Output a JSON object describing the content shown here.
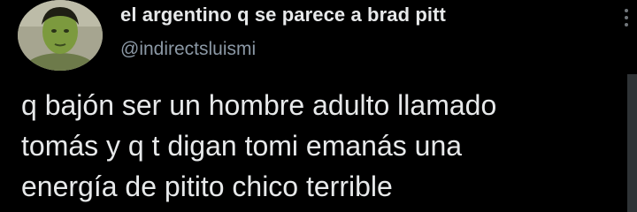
{
  "tweet": {
    "author": {
      "display_name": "el argentino q se parece a brad pitt",
      "handle": "@indirectsluismi"
    },
    "text": "q bajón ser un hombre adulto llamado\ntomás y q t digan tomi emanás una\nenergía de pitito chico terrible",
    "more_icon": "more-vertical-icon"
  },
  "colors": {
    "background": "#000000",
    "primary_text": "#e7e9ea",
    "secondary_text": "#8b98a5"
  }
}
